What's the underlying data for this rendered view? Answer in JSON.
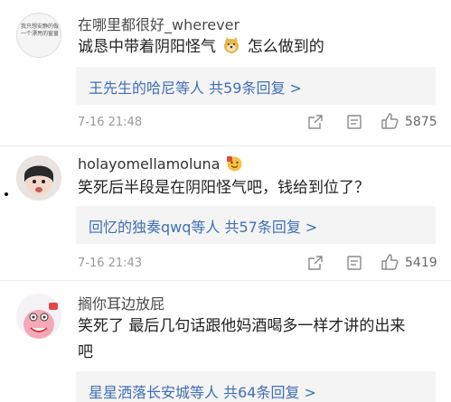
{
  "comments": [
    {
      "username": "在哪里都很好_wherever",
      "avatar_text": "我只想安静的做一个漂亮的窗童",
      "content": "诚恳中带着阴阳怪气",
      "content_suffix": "怎么做到的",
      "emoji_icon": "doge-emoji",
      "replies_text": "王先生的哈尼等人 共59条回复 >",
      "time": "7-16 21:48",
      "likes": "5875"
    },
    {
      "username": "holayomellamoluna",
      "badge_icon": "vip-badge-icon",
      "content": "笑死后半段是在阴阳怪气吧，钱给到位了？",
      "replies_text": "回忆的独奏qwq等人 共57条回复 >",
      "time": "7-16 21:43",
      "likes": "5419"
    },
    {
      "username": "搁你耳边放屁",
      "content_line1": "笑死了 最后几句话跟他妈酒喝多一样才讲的出来",
      "content_line2": "吧",
      "replies_text": "星星洒落长安城等人 共64条回复 >"
    }
  ],
  "colors": {
    "link_blue": "#3f6fb5",
    "reply_bg": "#f4f4f4",
    "meta_gray": "#9a9a9a"
  }
}
